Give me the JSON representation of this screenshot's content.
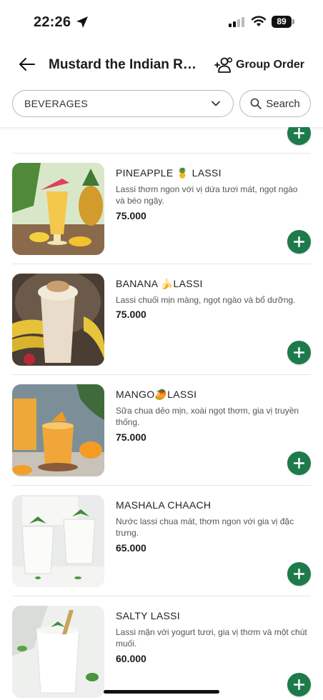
{
  "status": {
    "time": "22:26",
    "battery": "89"
  },
  "header": {
    "title": "Mustard the Indian Re...",
    "group_order_label": "Group Order"
  },
  "filter": {
    "category": "BEVERAGES",
    "search_label": "Search"
  },
  "items": [
    {
      "name": "PINEAPPLE 🍍 LASSI",
      "description": "Lassi thơm ngon với vị dứa tươi mát, ngọt ngào và béo ngậy.",
      "price": "75.000"
    },
    {
      "name": "BANANA 🍌LASSI",
      "description": "Lassi chuối mịn màng, ngọt ngào và bổ dưỡng.",
      "price": "75.000"
    },
    {
      "name": "MANGO🥭LASSI",
      "description": "Sữa chua dẻo mịn, xoài ngọt thơm, gia vị truyền thống.",
      "price": "75.000"
    },
    {
      "name": "MASHALA CHAACH",
      "description": "Nước lassi chua mát, thơm ngon với gia vị đặc trưng.",
      "price": "65.000"
    },
    {
      "name": "SALTY LASSI",
      "description": "Lassi mặn với yogurt tươi, gia vị thơm và một chút muối.",
      "price": "60.000"
    }
  ],
  "colors": {
    "accent": "#1d7a4a",
    "divider": "#e6e6e6"
  }
}
